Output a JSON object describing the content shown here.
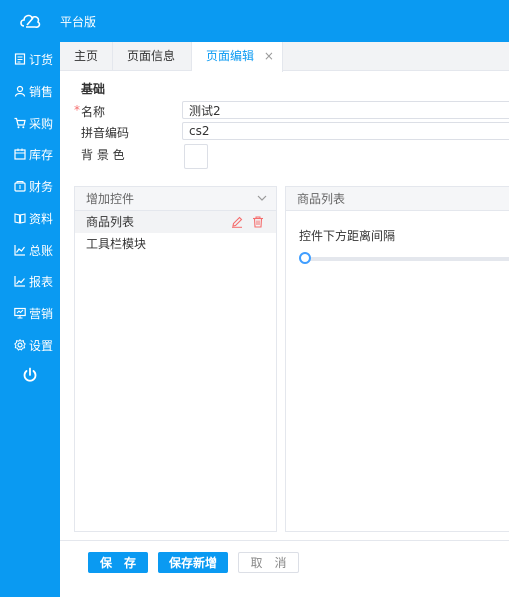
{
  "app": {
    "title": "平台版"
  },
  "sidebar": {
    "items": [
      {
        "label": "订货",
        "icon": "order-icon"
      },
      {
        "label": "销售",
        "icon": "user-icon"
      },
      {
        "label": "采购",
        "icon": "cart-icon"
      },
      {
        "label": "库存",
        "icon": "calendar-icon"
      },
      {
        "label": "财务",
        "icon": "wallet-icon"
      },
      {
        "label": "资料",
        "icon": "book-icon"
      },
      {
        "label": "总账",
        "icon": "chart-icon"
      },
      {
        "label": "报表",
        "icon": "report-icon"
      },
      {
        "label": "营销",
        "icon": "monitor-icon"
      },
      {
        "label": "设置",
        "icon": "gear-icon"
      }
    ],
    "power_icon": "power-icon"
  },
  "tabs": [
    {
      "label": "主页"
    },
    {
      "label": "页面信息"
    },
    {
      "label": "页面编辑",
      "active": true,
      "close": "×"
    }
  ],
  "form": {
    "section_title": "基础",
    "required_mark": "*",
    "name_label": "名称",
    "name_value": "测试2",
    "pinyin_label": "拼音编码",
    "pinyin_value": "cs2",
    "bg_label": "背 景 色"
  },
  "controls_panel": {
    "title": "增加控件",
    "items": [
      {
        "label": "商品列表"
      },
      {
        "label": "工具栏模块"
      }
    ]
  },
  "props_panel": {
    "title": "商品列表",
    "field_label": "控件下方距离间隔",
    "slider_value": 0
  },
  "footer": {
    "save": "保　存",
    "save_new": "保存新增",
    "cancel": "取　消"
  },
  "colors": {
    "brand": "#0a9af2",
    "danger": "#f56c6c",
    "slider": "#409eff"
  }
}
